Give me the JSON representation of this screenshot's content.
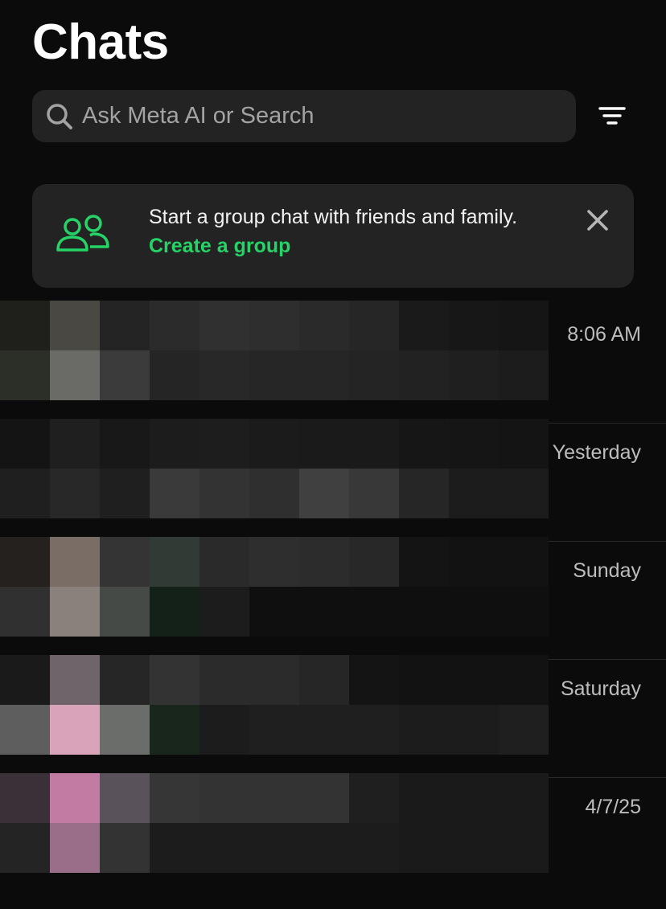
{
  "header": {
    "title": "Chats"
  },
  "search": {
    "placeholder": "Ask Meta AI or Search",
    "value": "",
    "icon": "search-icon"
  },
  "filter": {
    "icon": "filter-icon"
  },
  "banner": {
    "icon": "group-icon",
    "text": "Start a group chat with friends and family. ",
    "link_label": "Create a group",
    "close_icon": "close-icon"
  },
  "chats": [
    {
      "time": "8:06 AM"
    },
    {
      "time": "Yesterday"
    },
    {
      "time": "Sunday"
    },
    {
      "time": "Saturday"
    },
    {
      "time": "4/7/25"
    }
  ],
  "colors": {
    "background": "#0b0b0b",
    "surface": "#232323",
    "accent": "#25d366",
    "secondary_text": "#bdbdbd"
  }
}
